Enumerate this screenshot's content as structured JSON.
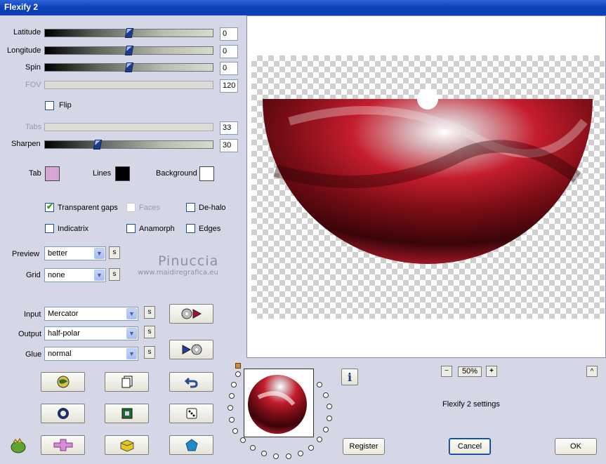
{
  "window": {
    "title": "Flexify 2"
  },
  "sliders": [
    {
      "label": "Latitude",
      "value": "0",
      "fraction": 0.5,
      "enabled": true
    },
    {
      "label": "Longitude",
      "value": "0",
      "fraction": 0.5,
      "enabled": true
    },
    {
      "label": "Spin",
      "value": "0",
      "fraction": 0.5,
      "enabled": true
    },
    {
      "label": "FOV",
      "value": "120",
      "fraction": null,
      "enabled": false
    },
    {
      "label": "Tabs",
      "value": "33",
      "fraction": null,
      "enabled": false
    },
    {
      "label": "Sharpen",
      "value": "30",
      "fraction": 0.3,
      "enabled": true
    }
  ],
  "flip": {
    "label": "Flip",
    "checked": false
  },
  "colors": {
    "tab": {
      "label": "Tab",
      "color": "#d6a5d6"
    },
    "lines": {
      "label": "Lines",
      "color": "#000000"
    },
    "background": {
      "label": "Background",
      "color": "#ffffff"
    }
  },
  "options": {
    "transparent_gaps": {
      "label": "Transparent gaps",
      "checked": true
    },
    "faces": {
      "label": "Faces",
      "checked": false,
      "enabled": false
    },
    "dehalo": {
      "label": "De-halo",
      "checked": false
    },
    "indicatrix": {
      "label": "Indicatrix",
      "checked": false
    },
    "anamorph": {
      "label": "Anamorph",
      "checked": false
    },
    "edges": {
      "label": "Edges",
      "checked": false
    }
  },
  "preview_quality": {
    "label": "Preview",
    "value": "better"
  },
  "grid": {
    "label": "Grid",
    "value": "none"
  },
  "input": {
    "label": "Input",
    "value": "Mercator"
  },
  "output": {
    "label": "Output",
    "value": "half-polar"
  },
  "glue": {
    "label": "Glue",
    "value": "normal"
  },
  "s_label": "s",
  "watermark": {
    "name": "Pinuccia",
    "site": "www.maidiregrafica.eu"
  },
  "zoom": {
    "minus": "−",
    "value": "50%",
    "plus": "+"
  },
  "up_arrow": "^",
  "info_icon": "i",
  "settings_text": "Flexify 2 settings",
  "buttons": {
    "register": "Register",
    "cancel": "Cancel",
    "ok": "OK"
  }
}
